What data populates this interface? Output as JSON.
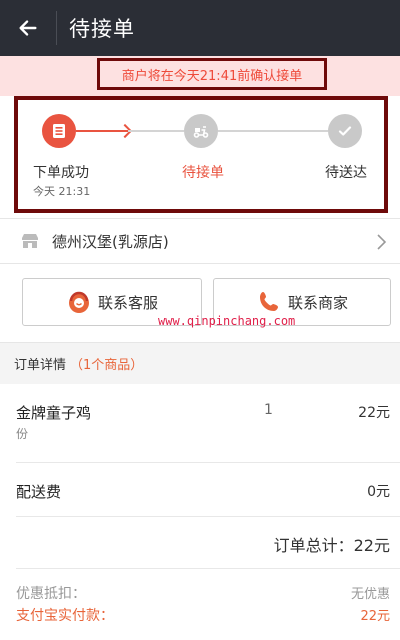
{
  "header": {
    "title": "待接单"
  },
  "notice": {
    "text": "商户将在今天21:41前确认接单"
  },
  "progress": {
    "steps": [
      {
        "label": "下单成功",
        "time": "今天 21:31",
        "state": "done",
        "icon": "order-icon"
      },
      {
        "label": "待接单",
        "state": "current",
        "icon": "scooter-icon"
      },
      {
        "label": "待送达",
        "state": "pending",
        "icon": "check-icon"
      }
    ]
  },
  "store": {
    "name": "德州汉堡(乳源店)"
  },
  "contact": {
    "service_label": "联系客服",
    "merchant_label": "联系商家"
  },
  "watermark": "www.qinpinchang.com",
  "order": {
    "header_label": "订单详情",
    "count": "（1个商品）",
    "items": [
      {
        "name": "金牌童子鸡",
        "unit": "份",
        "qty": "1",
        "price": "22元"
      }
    ],
    "delivery_label": "配送费",
    "delivery_fee": "0元",
    "total_text": "订单总计：22元",
    "discount_label": "优惠抵扣：",
    "discount_value": "无优惠",
    "pay_label": "支付宝实付款：",
    "pay_value": "22元"
  },
  "colors": {
    "header_bg": "#2b2e36",
    "accent": "#e95440",
    "highlight_border": "#6e0a0a",
    "notice_bg": "#fde1e1"
  }
}
